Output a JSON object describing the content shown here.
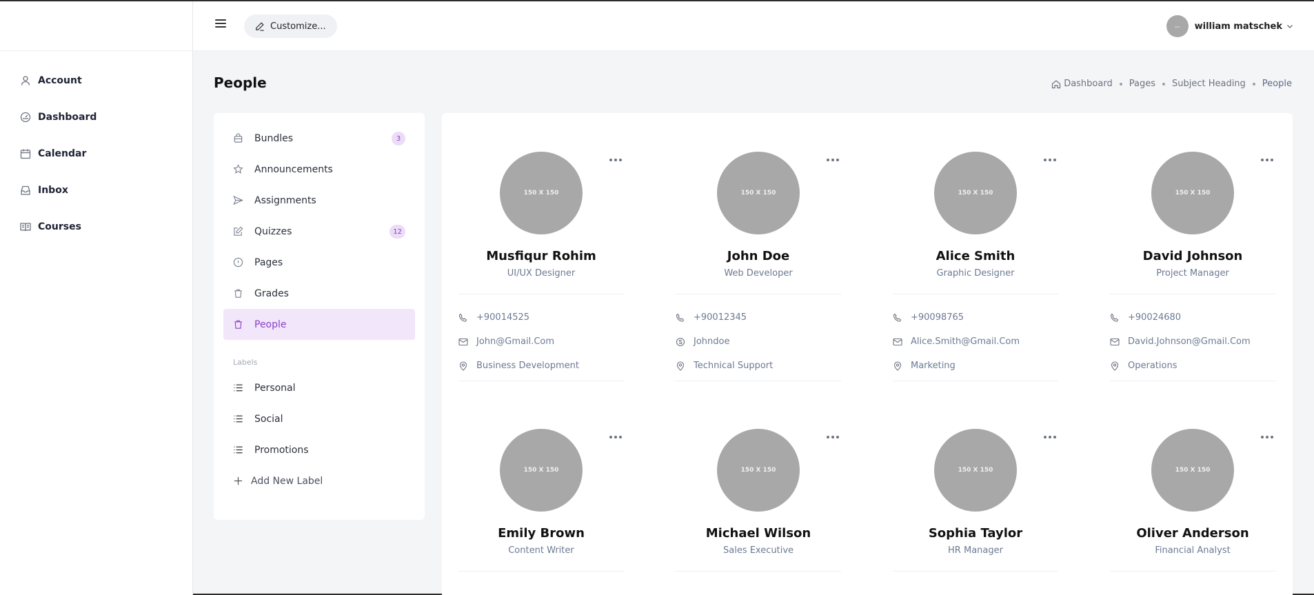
{
  "sidebar": {
    "items": [
      {
        "label": "Account",
        "icon": "user-icon"
      },
      {
        "label": "Dashboard",
        "icon": "gauge-icon"
      },
      {
        "label": "Calendar",
        "icon": "calendar-icon"
      },
      {
        "label": "Inbox",
        "icon": "inbox-icon"
      },
      {
        "label": "Courses",
        "icon": "book-icon"
      }
    ]
  },
  "header": {
    "customize_label": "Customize...",
    "user_name": "william matschek"
  },
  "page": {
    "title": "People",
    "breadcrumb": [
      "Dashboard",
      "Pages",
      "Subject Heading",
      "People"
    ]
  },
  "panel": {
    "items": [
      {
        "label": "Bundles",
        "badge": "3"
      },
      {
        "label": "Announcements",
        "badge": ""
      },
      {
        "label": "Assignments",
        "badge": ""
      },
      {
        "label": "Quizzes",
        "badge": "12"
      },
      {
        "label": "Pages",
        "badge": ""
      },
      {
        "label": "Grades",
        "badge": ""
      },
      {
        "label": "People",
        "badge": ""
      }
    ],
    "labels_heading": "Labels",
    "labels": [
      "Personal",
      "Social",
      "Promotions"
    ],
    "add_label": "Add New Label"
  },
  "people": [
    {
      "photo": "150 X 150",
      "name": "Musfiqur Rohim",
      "role": "UI/UX Designer",
      "phone": "+90014525",
      "contact": "John@Gmail.Com",
      "contact_icon": "mail-icon",
      "department": "Business Development"
    },
    {
      "photo": "150 X 150",
      "name": "John Doe",
      "role": "Web Developer",
      "phone": "+90012345",
      "contact": "Johndoe",
      "contact_icon": "skype-icon",
      "department": "Technical Support"
    },
    {
      "photo": "150 X 150",
      "name": "Alice Smith",
      "role": "Graphic Designer",
      "phone": "+90098765",
      "contact": "Alice.Smith@Gmail.Com",
      "contact_icon": "mail-icon",
      "department": "Marketing"
    },
    {
      "photo": "150 X 150",
      "name": "David Johnson",
      "role": "Project Manager",
      "phone": "+90024680",
      "contact": "David.Johnson@Gmail.Com",
      "contact_icon": "mail-icon",
      "department": "Operations"
    },
    {
      "photo": "150 X 150",
      "name": "Emily Brown",
      "role": "Content Writer"
    },
    {
      "photo": "150 X 150",
      "name": "Michael Wilson",
      "role": "Sales Executive"
    },
    {
      "photo": "150 X 150",
      "name": "Sophia Taylor",
      "role": "HR Manager"
    },
    {
      "photo": "150 X 150",
      "name": "Oliver Anderson",
      "role": "Financial Analyst"
    }
  ],
  "colors": {
    "accent": "#8b3fc8",
    "accent_bg": "#f1e6fa",
    "page_bg": "#f4f5f7"
  }
}
